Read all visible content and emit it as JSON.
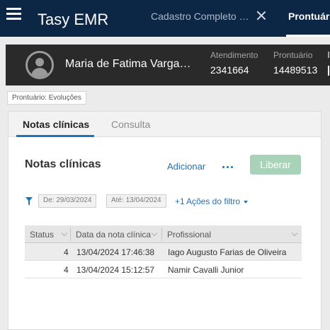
{
  "header": {
    "app_title": "Tasy EMR",
    "tabs": [
      {
        "label": "Cadastro Completo de Pessoa Física",
        "closable": true,
        "active": false
      },
      {
        "label": "Prontuário",
        "active": true
      }
    ]
  },
  "patient": {
    "name": "Maria de Fatima Vargas Silva",
    "atendimento_label": "Atendimento",
    "atendimento_value": "2341664",
    "prontuario_label": "Prontuário",
    "prontuario_value": "14489513"
  },
  "breadcrumb": "Prontuário: Evoluções",
  "panel": {
    "tabs": [
      {
        "label": "Notas clínicas",
        "active": true
      },
      {
        "label": "Consulta",
        "active": false
      }
    ],
    "section_title": "Notas clínicas",
    "add_label": "Adicionar",
    "liberar_label": "Liberar",
    "filter": {
      "from": "De: 29/03/2024",
      "to": "Até: 13/04/2024",
      "extra_count": "+1",
      "actions_label": "Ações do filtro"
    },
    "grid": {
      "columns": [
        "Status",
        "Data da nota clínica",
        "Profissional"
      ],
      "rows": [
        {
          "status": "4",
          "date": "13/04/2024 17:46:38",
          "professional": "Iago Augusto Farias de Oliveira"
        },
        {
          "status": "4",
          "date": "13/04/2024 15:12:57",
          "professional": "Namir Cavalli Junior"
        }
      ]
    }
  },
  "colors": {
    "topbar": "#0c2646",
    "patient_bar": "#2a2a2a",
    "accent": "#1a73bb",
    "link": "#2171b5",
    "liberar_button": "#a9d3b9"
  }
}
